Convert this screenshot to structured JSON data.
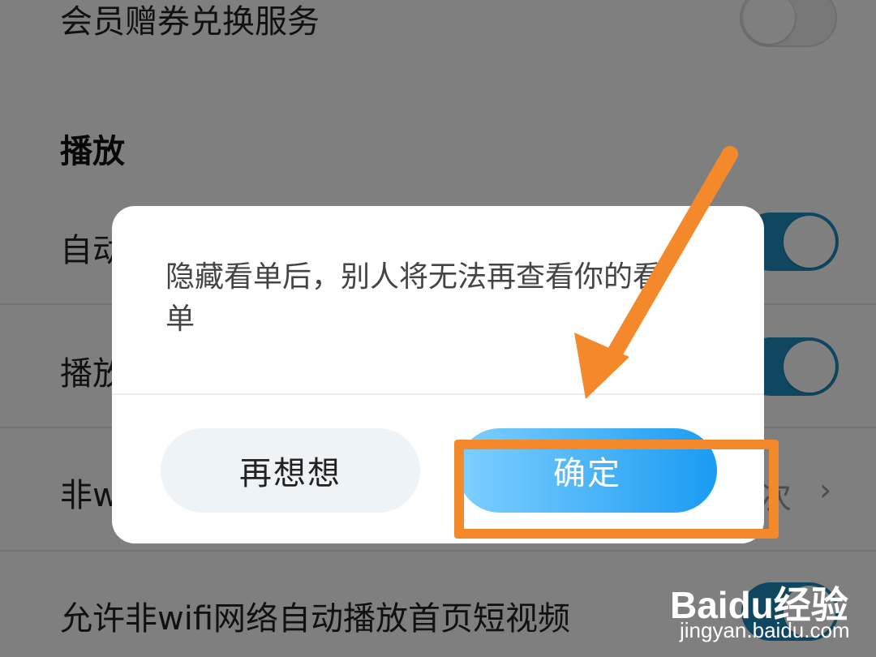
{
  "settings": {
    "rows": [
      {
        "label": "会员赠券兑换服务"
      },
      {
        "label": "自动"
      },
      {
        "label": "播放"
      },
      {
        "label": "非w"
      },
      {
        "label": "允许非wifi网络自动播放首页短视频"
      }
    ],
    "section_playback": "播放",
    "row_value": "次",
    "chevron": "›"
  },
  "dialog": {
    "message": "隐藏看单后，别人将无法再查看你的看单",
    "cancel_label": "再想想",
    "confirm_label": "确定"
  },
  "watermark": {
    "logo": "Baidu经验",
    "url": "jingyan.baidu.com"
  },
  "colors": {
    "accent_blue": "#1a9bf3",
    "annotation_orange": "#f4892b",
    "toggle_on": "#1f8fc2"
  }
}
